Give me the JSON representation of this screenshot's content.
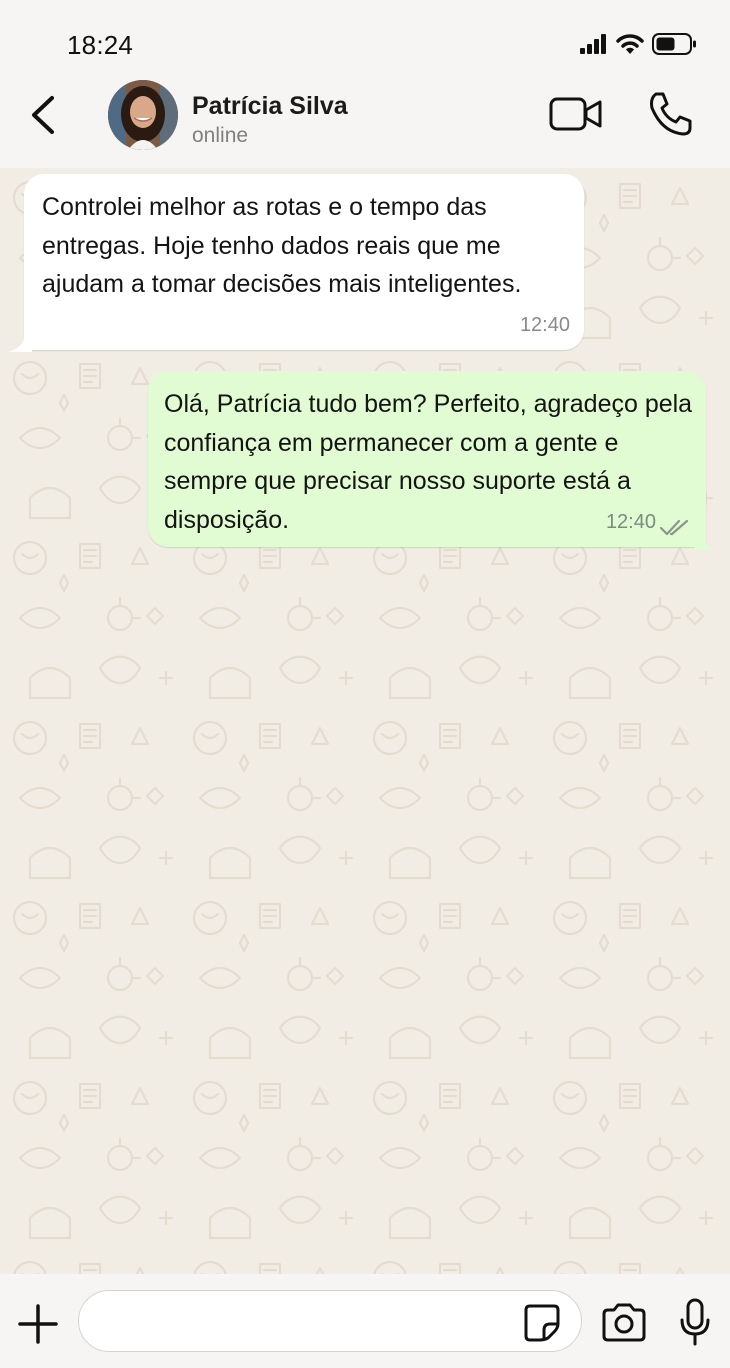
{
  "status_bar": {
    "time": "18:24"
  },
  "header": {
    "contact_name": "Patrícia Silva",
    "contact_status": "online"
  },
  "messages": [
    {
      "direction": "incoming",
      "text": "Controlei melhor as rotas e o tempo das entregas. Hoje tenho dados reais que me ajudam a tomar decisões mais inteligentes.",
      "time": "12:40"
    },
    {
      "direction": "outgoing",
      "text": "Olá, Patrícia tudo bem? Perfeito, agradeço pela confiança em permanecer com a gente e sempre que precisar nosso suporte está a disposição.",
      "time": "12:40",
      "status": "read"
    }
  ],
  "input": {
    "placeholder": ""
  },
  "colors": {
    "outgoing_bubble": "#e1fbd3",
    "incoming_bubble": "#ffffff",
    "chat_background": "#f1ede5",
    "bar_background": "#f6f5f3"
  },
  "icons": [
    "signal-icon",
    "wifi-icon",
    "battery-icon",
    "back-icon",
    "video-call-icon",
    "phone-icon",
    "double-check-icon",
    "plus-icon",
    "sticker-icon",
    "camera-icon",
    "mic-icon"
  ]
}
